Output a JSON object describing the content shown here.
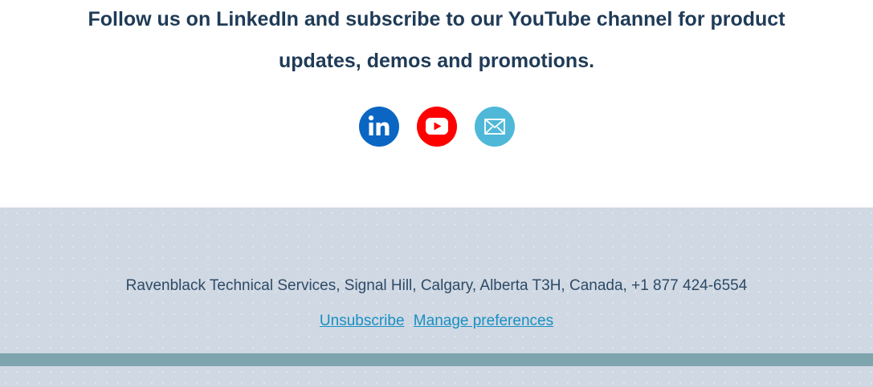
{
  "follow": {
    "text_line1": "Follow us on LinkedIn and subscribe to our YouTube channel for product",
    "text_line2": "updates, demos and promotions."
  },
  "social": {
    "icons": [
      {
        "name": "linkedin-icon",
        "color": "#0a66c2"
      },
      {
        "name": "youtube-icon",
        "color": "#ff0000"
      },
      {
        "name": "email-icon",
        "color": "#4fb8d8"
      }
    ]
  },
  "footer": {
    "address": "Ravenblack Technical Services, Signal Hill, Calgary, Alberta T3H, Canada, +1 877 424-6554",
    "unsubscribe_label": "Unsubscribe",
    "manage_label": "Manage preferences",
    "link_color": "#1a8fc2",
    "band_color": "#7ea4ae",
    "background_color": "#cfd8e3"
  }
}
